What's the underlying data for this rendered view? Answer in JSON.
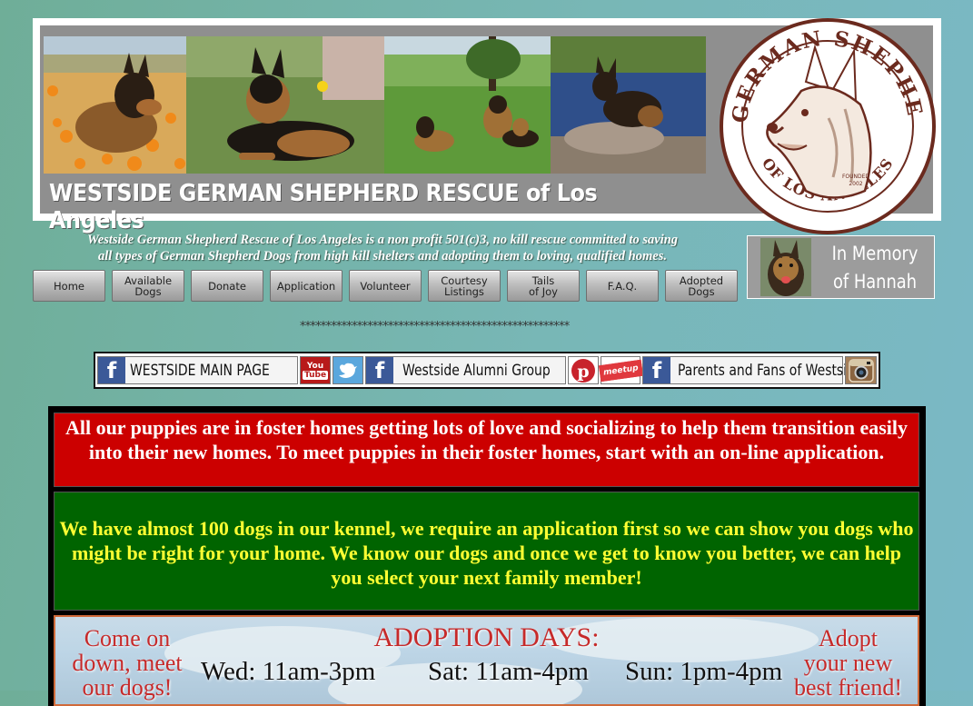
{
  "banner": {
    "title": "WESTSIDE GERMAN SHEPHERD RESCUE of Los Angeles",
    "seal": {
      "top_text": "WESTSIDE GERMAN SHEPHERD RESCUE",
      "bottom_text": "OF LOS ANGELES",
      "founded": "FOUNDED",
      "year": "2002"
    }
  },
  "mission": {
    "line1": "Westside German Shepherd Rescue of Los Angeles is a non profit 501(c)3, no kill rescue committed to saving",
    "line2": "all types of German Shepherd Dogs from high kill shelters and adopting them to loving, qualified homes."
  },
  "memory": {
    "line1": "In Memory",
    "line2": "of Hannah"
  },
  "nav": {
    "items": [
      {
        "label": "Home"
      },
      {
        "label": "Available\nDogs"
      },
      {
        "label": "Donate"
      },
      {
        "label": "Application"
      },
      {
        "label": "Volunteer"
      },
      {
        "label": "Courtesy\nListings"
      },
      {
        "label": "Tails\nof Joy"
      },
      {
        "label": "F.A.Q."
      },
      {
        "label": "Adopted\nDogs"
      }
    ]
  },
  "divider": "****************************************************",
  "social": {
    "main_page": "WESTSIDE MAIN PAGE",
    "youtube_top": "You",
    "youtube_bottom": "Tube",
    "alumni": "Westside Alumni Group",
    "meetup": "meetup",
    "fans": "Parents and Fans of Westside"
  },
  "notices": {
    "puppies": "All our puppies are in foster homes getting lots of love and socializing to help them transition easily into their new homes. To meet puppies in their foster homes, start with an on-line application.",
    "kennel": "We have almost 100 dogs in our kennel, we require an application first so we can show you dogs who might be right for your home. We know our dogs and once we get to know you better, we can help you select your next family member!"
  },
  "adoption": {
    "title": "ADOPTION DAYS:",
    "left_line1": "Come on",
    "left_line2": "down, meet",
    "left_line3": "our dogs!",
    "right_line1": "Adopt",
    "right_line2": "your new",
    "right_line3": "best friend!",
    "days": [
      {
        "label": "Wed: 11am-3pm"
      },
      {
        "label": "Sat: 11am-4pm"
      },
      {
        "label": "Sun: 1pm-4pm"
      }
    ]
  },
  "colors": {
    "notice_red": "#cc0000",
    "notice_green": "#006400",
    "notice_green_text": "#ffff33",
    "facebook": "#3b5998",
    "adoption_red": "#c62a2a"
  }
}
